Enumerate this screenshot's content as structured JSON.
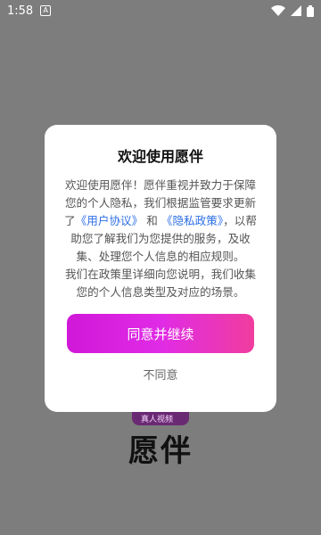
{
  "status_bar": {
    "time": "1:58",
    "notification_glyph": "A",
    "icons": [
      "wifi-icon",
      "signal-icon",
      "battery-icon"
    ]
  },
  "background": {
    "logo_text": "真人视频",
    "app_name": "愿伴"
  },
  "dialog": {
    "title": "欢迎使用愿伴",
    "paragraph1_start": "欢迎使用愿伴！愿伴重视并致力于保障您的个人隐私，我们根据监管要求更新了",
    "link_user_agreement": "《用户协议》",
    "connector_and": "和",
    "link_privacy_policy": "《隐私政策》",
    "paragraph1_end": "，以帮助您了解我们为您提供的服务，及收集、处理您个人信息的相应规则。",
    "paragraph2": "我们在政策里详细向您说明，我们收集您的个人信息类型及对应的场景。",
    "agree_label": "同意并继续",
    "decline_label": "不同意"
  },
  "colors": {
    "accent_gradient_start": "#d018d8",
    "accent_gradient_end": "#f03d9e",
    "link": "#2d6fe6",
    "overlay": "#7d7d7d"
  }
}
